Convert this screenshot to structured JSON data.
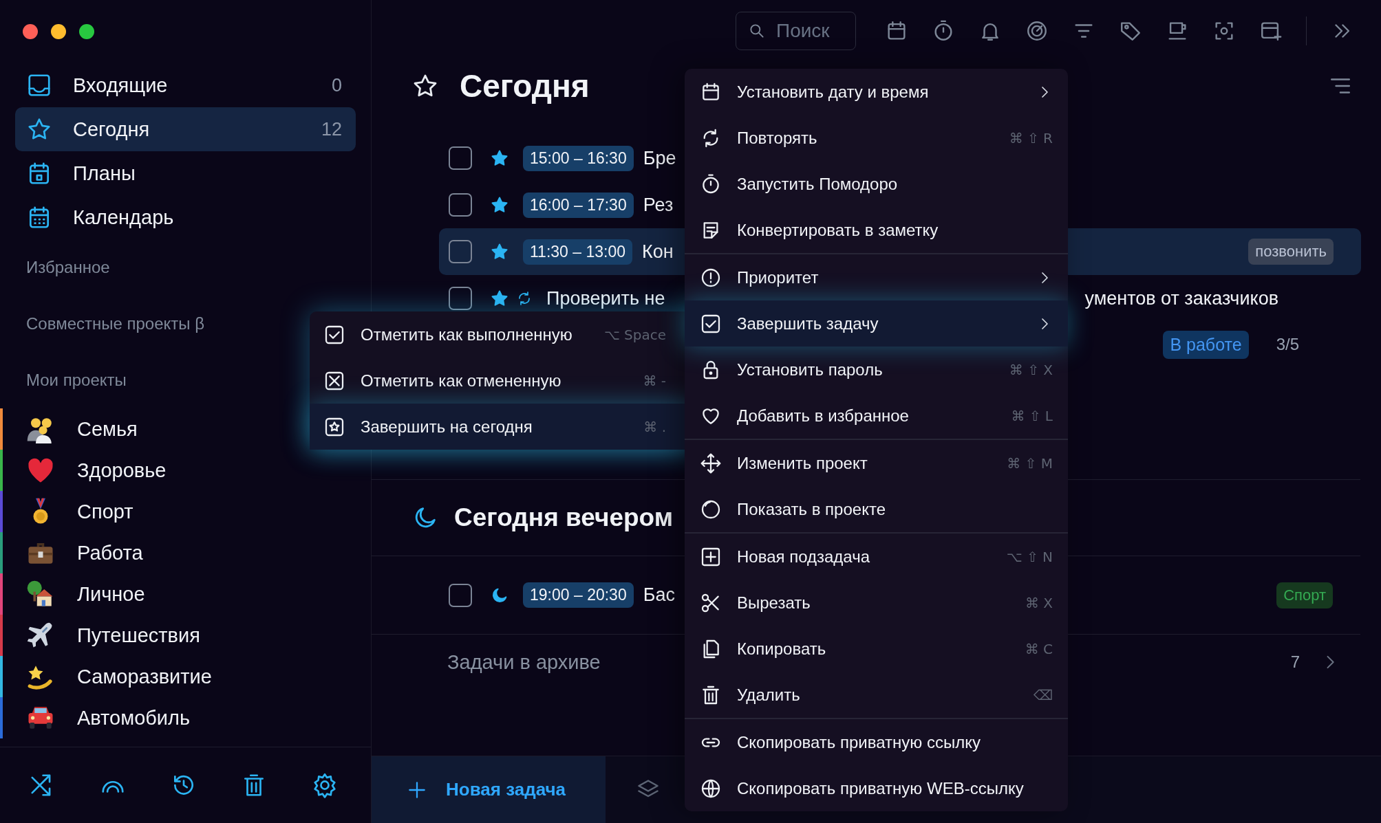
{
  "window_controls": [
    {
      "color": "#fe5f57"
    },
    {
      "color": "#febc2e"
    },
    {
      "color": "#28c840"
    }
  ],
  "sidebar": {
    "nav": [
      {
        "label": "Входящие",
        "count": "0",
        "selected": false
      },
      {
        "label": "Сегодня",
        "count": "12",
        "selected": true
      },
      {
        "label": "Планы",
        "selected": false
      },
      {
        "label": "Календарь",
        "selected": false
      }
    ],
    "sections": [
      "Избранное",
      "Совместные проекты β",
      "Мои проекты"
    ],
    "projects": [
      {
        "name": "Семья",
        "color": "#f08a3c"
      },
      {
        "name": "Здоровье",
        "color": "#39b54a"
      },
      {
        "name": "Спорт",
        "color": "#5b4bd6"
      },
      {
        "name": "Работа",
        "color": "#2a9d7c"
      },
      {
        "name": "Личное",
        "color": "#e2457b"
      },
      {
        "name": "Путешествия",
        "color": "#d63a4a"
      },
      {
        "name": "Саморазвитие",
        "color": "#33b7e2"
      },
      {
        "name": "Автомобиль",
        "color": "#2b6bd9"
      }
    ]
  },
  "toolbar": {
    "search": {
      "placeholder": "Поиск"
    }
  },
  "main": {
    "title": "Сегодня",
    "tasks": [
      {
        "kind": "star",
        "repeating": false,
        "time": "15:00 – 16:30",
        "title": "Бре",
        "selected": false
      },
      {
        "kind": "star",
        "repeating": false,
        "time": "16:00 – 17:30",
        "title": "Рез",
        "selected": false
      },
      {
        "kind": "star",
        "repeating": false,
        "time": "11:30 – 13:00",
        "title": "Кон",
        "tag": {
          "label": "позвонить",
          "color": "#394255"
        },
        "selected": true
      },
      {
        "kind": "star",
        "repeating": true,
        "title": "Проверить не",
        "title_end": "ументов от заказчиков",
        "status": {
          "label": "В работе",
          "color": "#0f3560"
        },
        "progress": "3/5",
        "selected": false
      }
    ],
    "evening": {
      "title": "Сегодня вечером",
      "tasks": [
        {
          "kind": "moon",
          "repeating": false,
          "time": "19:00 – 20:30",
          "title": "Бас",
          "tag": {
            "label": "Спорт",
            "color": "#16391f"
          },
          "selected": false
        }
      ]
    },
    "archive": {
      "label": "Задачи в архиве",
      "count": "7"
    },
    "new_task": "Новая задача"
  },
  "context_menu": {
    "groups": [
      [
        {
          "label": "Установить дату и время",
          "submenu": true,
          "selected": false
        },
        {
          "label": "Повторять",
          "shortcut": "⌘ ⇧ R",
          "submenu": false,
          "selected": false
        },
        {
          "label": "Запустить Помодоро",
          "submenu": false,
          "selected": false
        },
        {
          "label": "Конвертировать в заметку",
          "submenu": false,
          "selected": false
        }
      ],
      [
        {
          "label": "Приоритет",
          "submenu": true,
          "selected": false
        },
        {
          "label": "Завершить задачу",
          "submenu": true,
          "selected": true
        },
        {
          "label": "Установить пароль",
          "shortcut": "⌘ ⇧ X",
          "submenu": false,
          "selected": false
        },
        {
          "label": "Добавить в избранное",
          "shortcut": "⌘ ⇧ L",
          "submenu": false,
          "selected": false
        }
      ],
      [
        {
          "label": "Изменить проект",
          "shortcut": "⌘ ⇧ M",
          "submenu": false,
          "selected": false
        },
        {
          "label": "Показать в проекте",
          "submenu": false,
          "selected": false
        }
      ],
      [
        {
          "label": "Новая подзадача",
          "shortcut": "⌥ ⇧ N",
          "submenu": false,
          "selected": false
        },
        {
          "label": "Вырезать",
          "shortcut": "⌘ X",
          "submenu": false,
          "selected": false
        },
        {
          "label": "Копировать",
          "shortcut": "⌘ C",
          "submenu": false,
          "selected": false
        },
        {
          "label": "Удалить",
          "shortcut": "⌫",
          "submenu": false,
          "selected": false
        }
      ],
      [
        {
          "label": "Скопировать приватную ссылку",
          "submenu": false,
          "selected": false
        },
        {
          "label": "Скопировать приватную WEB-ссылку",
          "submenu": false,
          "selected": false
        }
      ]
    ]
  },
  "submenu": {
    "items": [
      {
        "label": "Отметить как выполненную",
        "shortcut": "⌥ Space",
        "selected": false
      },
      {
        "label": "Отметить как отмененную",
        "shortcut": "⌘ -",
        "selected": false
      },
      {
        "label": "Завершить на сегодня",
        "shortcut": "⌘ .",
        "selected": true
      }
    ]
  }
}
